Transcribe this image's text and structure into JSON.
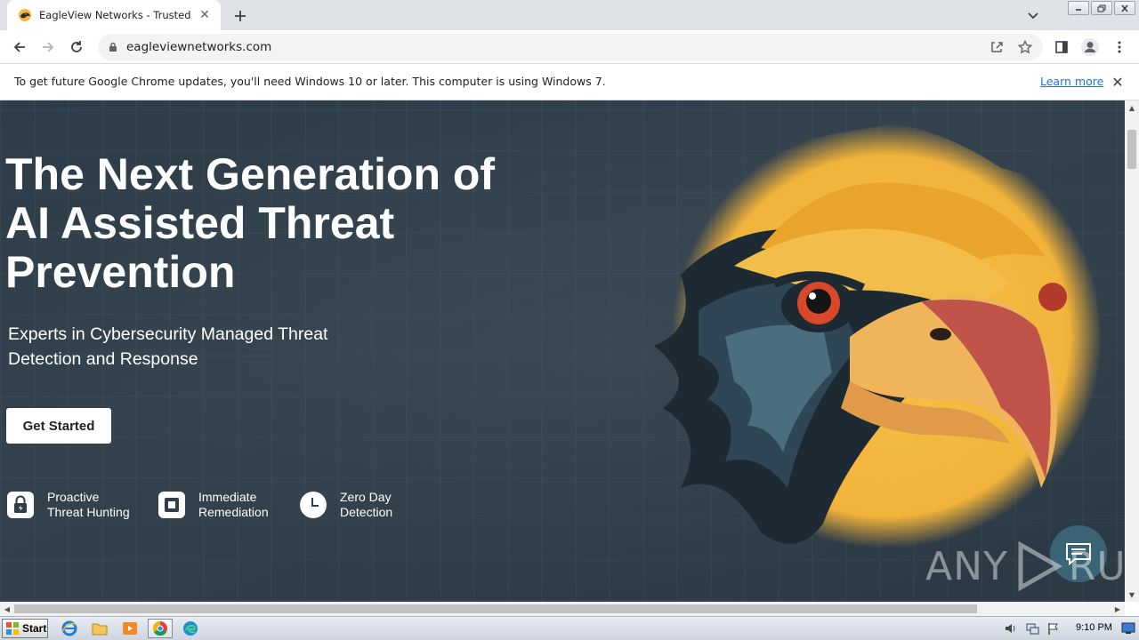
{
  "browser": {
    "tab_title": "EagleView Networks - Trusted Cyber",
    "new_tab_icon": "plus-icon",
    "url": "eagleviewnetworks.com"
  },
  "infobar": {
    "message": "To get future Google Chrome updates, you'll need Windows 10 or later. This computer is using Windows 7.",
    "link": "Learn more"
  },
  "hero": {
    "title_lines": [
      "The Next Generation of",
      "AI Assisted Threat",
      "Prevention"
    ],
    "subtitle_lines": [
      "Experts in Cybersecurity Managed Threat",
      "Detection and Response"
    ],
    "cta_label": "Get Started",
    "features": [
      {
        "line1": "Proactive",
        "line2": "Threat Hunting",
        "icon": "lock-icon"
      },
      {
        "line1": "Immediate",
        "line2": "Remediation",
        "icon": "shield-square-icon"
      },
      {
        "line1": "Zero Day",
        "line2": "Detection",
        "icon": "clock-icon"
      }
    ]
  },
  "watermark": {
    "left": "ANY",
    "right": "RUN"
  },
  "taskbar": {
    "start_label": "Start",
    "clock": "9:10 PM"
  },
  "colors": {
    "hero_background": "#2f3e4a",
    "link_blue": "#1a73e8",
    "eagle_yellow": "#f2b73d"
  }
}
